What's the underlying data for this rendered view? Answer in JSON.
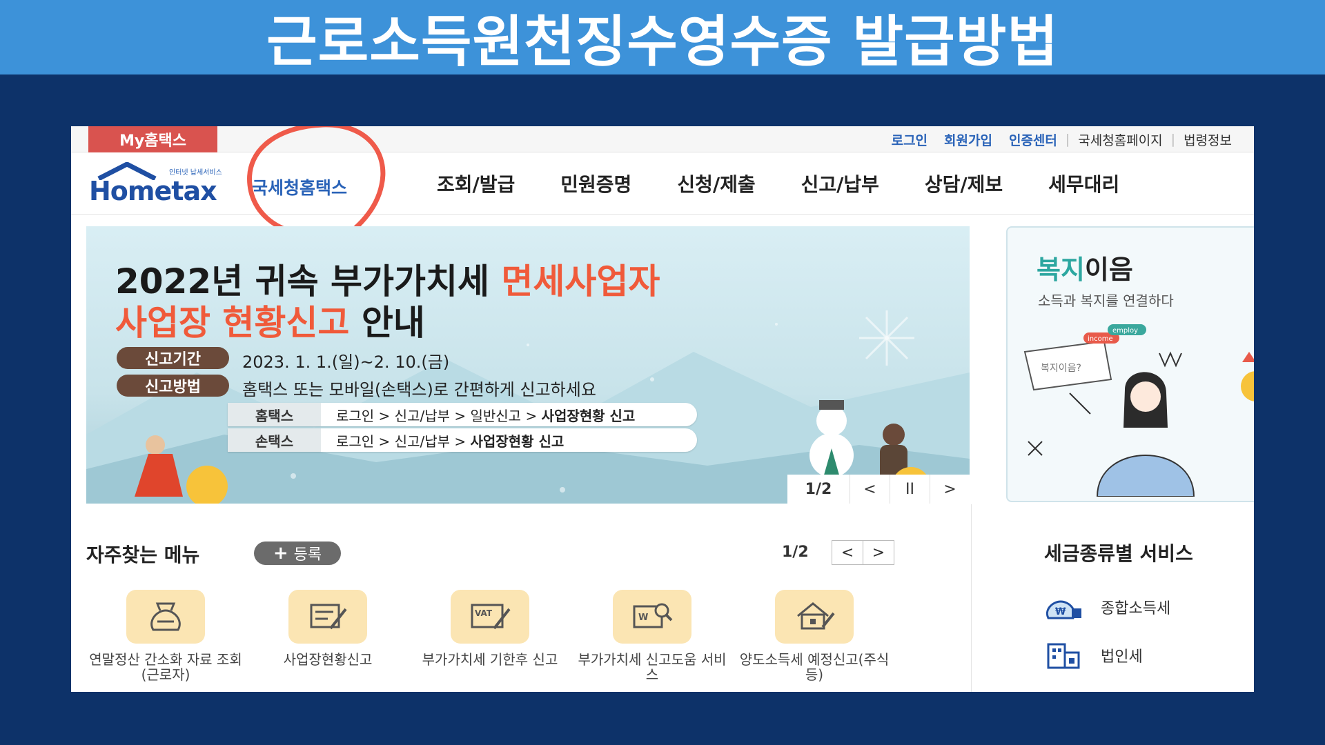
{
  "headline": "근로소득원천징수영수증 발급방법",
  "utilbar": {
    "my_tab": "My홈택스",
    "links": [
      "로그인",
      "회원가입",
      "인증센터"
    ],
    "separator": "|",
    "grey_links": [
      "국세청홈페이지",
      "법령정보"
    ]
  },
  "header": {
    "logo_small": "인터넷 납세서비스",
    "logo_text": "Hometax",
    "site_name": "국세청홈택스",
    "nav": [
      "조회/발급",
      "민원증명",
      "신청/제출",
      "신고/납부",
      "상담/제보",
      "세무대리"
    ]
  },
  "banner": {
    "title_line1_a": "2022년 귀속 부가가치세 ",
    "title_line1_b": "면세사업자",
    "title_line2_a": "사업장 현황신고",
    "title_line2_b": " 안내",
    "period_label": "신고기간",
    "period_value": "2023. 1. 1.(일)~2. 10.(금)",
    "method_label": "신고방법",
    "method_value": "홈택스 또는 모바일(손택스)로 간편하게 신고하세요",
    "route1_label": "홈택스",
    "route1_path": "로그인 > 신고/납부 > 일반신고 > ",
    "route1_bold": "사업장현황 신고",
    "route2_label": "손택스",
    "route2_path": "로그인 > 신고/납부 > ",
    "route2_bold": "사업장현황 신고",
    "counter": "1/2",
    "prev": "<",
    "pause": "II",
    "next": ">"
  },
  "side_banner": {
    "title_a": "복지",
    "title_b": "이음",
    "subtitle": "소득과 복지를 연결하다",
    "bubble_text": "복지이음?",
    "tag1": "income",
    "tag2": "employ"
  },
  "favorites": {
    "title": "자주찾는 메뉴",
    "register": "등록",
    "register_icon": "+",
    "page": "1/2",
    "prev": "<",
    "next": ">",
    "items": [
      {
        "label": "연말정산 간소화 자료 조회 (근로자)",
        "icon": "money-bag-icon"
      },
      {
        "label": "사업장현황신고",
        "icon": "report-edit-icon"
      },
      {
        "label": "부가가치세 기한후 신고",
        "icon": "vat-icon",
        "icon_text": "VAT"
      },
      {
        "label": "부가가치세 신고도움 서비스",
        "icon": "search-document-icon",
        "icon_text": "W"
      },
      {
        "label": "양도소득세 예정신고(주식등)",
        "icon": "house-icon"
      }
    ]
  },
  "tax_services": {
    "title": "세금종류별 서비스",
    "items": [
      {
        "label": "종합소득세",
        "icon": "won-bag-icon",
        "icon_text": "₩"
      },
      {
        "label": "법인세",
        "icon": "building-icon"
      }
    ]
  },
  "colors": {
    "top_band": "#3d92d9",
    "background": "#0d3269",
    "accent_red": "#f05a3a",
    "link_blue": "#2a63b8"
  }
}
